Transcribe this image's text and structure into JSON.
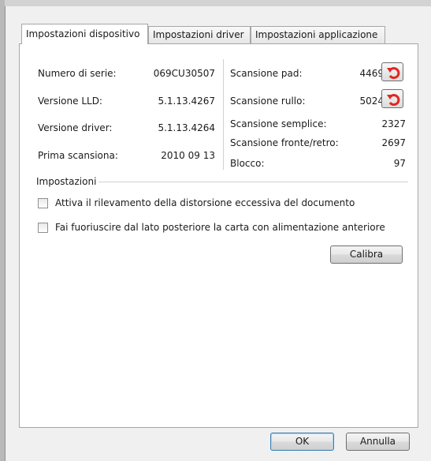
{
  "tabs": [
    {
      "label": "Impostazioni dispositivo",
      "active": true
    },
    {
      "label": "Impostazioni driver",
      "active": false
    },
    {
      "label": "Impostazioni applicazione",
      "active": false
    }
  ],
  "device_info": {
    "serial": {
      "label": "Numero di serie:",
      "value": "069CU30507"
    },
    "lld": {
      "label": "Versione LLD:",
      "value": "5.1.13.4267"
    },
    "driver": {
      "label": "Versione driver:",
      "value": "5.1.13.4264"
    },
    "first_scan": {
      "label": "Prima scansiona:",
      "value": "2010 09 13"
    }
  },
  "counters": {
    "pad": {
      "label": "Scansione pad:",
      "value": "4469"
    },
    "roller": {
      "label": "Scansione rullo:",
      "value": "5024"
    },
    "simplex": {
      "label": "Scansione semplice:",
      "value": "2327"
    },
    "duplex": {
      "label": "Scansione fronte/retro:",
      "value": "2697"
    },
    "jam": {
      "label": "Blocco:",
      "value": "97"
    }
  },
  "settings": {
    "group_label": "Impostazioni",
    "skew_detection": {
      "label": "Attiva il rilevamento della distorsione eccessiva del documento",
      "checked": false
    },
    "rear_eject": {
      "label": "Fai fuoriuscire dal lato posteriore la carta con alimentazione anteriore",
      "checked": false
    },
    "calibrate_label": "Calibra"
  },
  "footer": {
    "ok_label": "OK",
    "cancel_label": "Annulla"
  },
  "colors": {
    "reset_arrow": "#e0271f",
    "default_button_border": "#3c7fb1"
  }
}
